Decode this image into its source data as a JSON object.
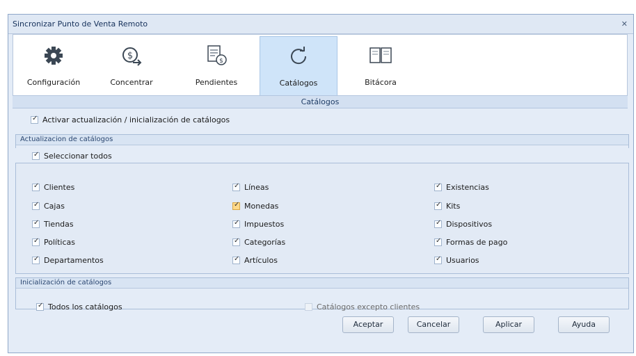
{
  "window": {
    "title": "Sincronizar Punto de Venta Remoto",
    "close_glyph": "✕"
  },
  "ribbon": {
    "buttons": [
      {
        "label": "Configuración",
        "icon": "gear-icon",
        "active": false
      },
      {
        "label": "Concentrar",
        "icon": "money-arrow-icon",
        "active": false
      },
      {
        "label": "Pendientes",
        "icon": "documents-money-icon",
        "active": false
      },
      {
        "label": "Catálogos",
        "icon": "refresh-icon",
        "active": true
      },
      {
        "label": "Bitácora",
        "icon": "book-icon",
        "active": false
      }
    ]
  },
  "section_title": "Catálogos",
  "activate": {
    "label": "Activar actualización / inicialización de catálogos",
    "checked": true
  },
  "update_group": {
    "title": "Actualizacion de catálogos",
    "select_all": {
      "label": "Seleccionar todos",
      "checked": true
    },
    "columns": [
      [
        {
          "label": "Clientes",
          "checked": true
        },
        {
          "label": "Cajas",
          "checked": true
        },
        {
          "label": "Tiendas",
          "checked": true
        },
        {
          "label": "Políticas",
          "checked": true
        },
        {
          "label": "Departamentos",
          "checked": true
        }
      ],
      [
        {
          "label": "Líneas",
          "checked": true
        },
        {
          "label": "Monedas",
          "checked": true,
          "highlight": true
        },
        {
          "label": "Impuestos",
          "checked": true
        },
        {
          "label": "Categorías",
          "checked": true
        },
        {
          "label": "Artículos",
          "checked": true
        }
      ],
      [
        {
          "label": "Existencias",
          "checked": true
        },
        {
          "label": "Kits",
          "checked": true
        },
        {
          "label": "Dispositivos",
          "checked": true
        },
        {
          "label": "Formas de pago",
          "checked": true
        },
        {
          "label": "Usuarios",
          "checked": true
        }
      ]
    ]
  },
  "init_group": {
    "title": "Inicialización de catálogos",
    "all": {
      "label": "Todos los catálogos",
      "checked": true
    },
    "except": {
      "label": "Catálogos excepto clientes",
      "checked": false,
      "disabled": true
    }
  },
  "buttons": {
    "accept": "Aceptar",
    "cancel": "Cancelar",
    "apply": "Aplicar",
    "help": "Ayuda"
  }
}
